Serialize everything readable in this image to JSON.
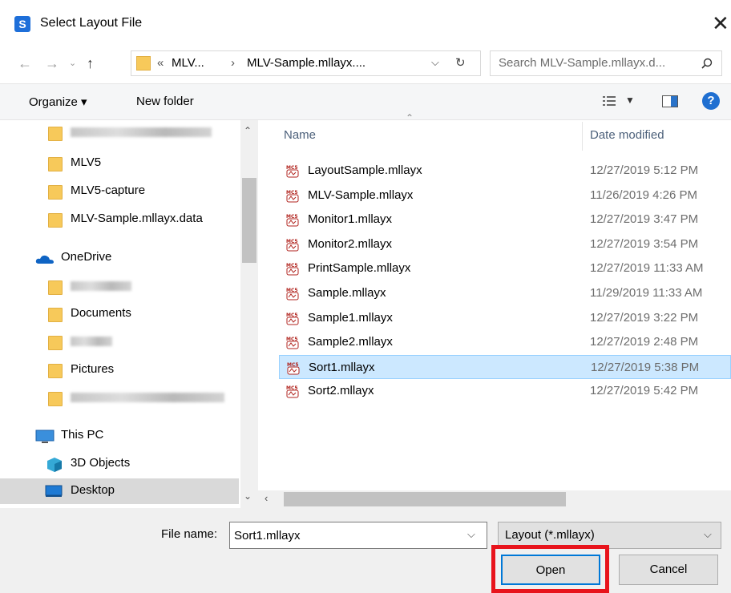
{
  "window": {
    "title": "Select Layout File",
    "app_icon_letter": "S",
    "close_glyph": "✕"
  },
  "address": {
    "path_parts": [
      "«",
      "MLV...",
      "›",
      "MLV-Sample.mllayx...."
    ],
    "search_placeholder": "Search MLV-Sample.mllayx.d..."
  },
  "toolbar": {
    "organize_label": "Organize ▾",
    "new_folder_label": "New folder"
  },
  "nav": {
    "items": [
      {
        "label": "",
        "blurred": true
      },
      {
        "label": "MLV5"
      },
      {
        "label": "MLV5-capture"
      },
      {
        "label": "MLV-Sample.mllayx.data"
      },
      {
        "label": "OneDrive"
      },
      {
        "label": "",
        "blurred": true
      },
      {
        "label": "Documents"
      },
      {
        "label": "",
        "blurred": true
      },
      {
        "label": "Pictures"
      },
      {
        "label": "",
        "blurred": true
      },
      {
        "label": "This PC"
      },
      {
        "label": "3D Objects"
      },
      {
        "label": "Desktop"
      }
    ]
  },
  "file_list": {
    "columns": [
      "Name",
      "Date modified"
    ],
    "files": [
      {
        "name": "LayoutSample.mllayx",
        "date": "12/27/2019 5:12 PM"
      },
      {
        "name": "MLV-Sample.mllayx",
        "date": "11/26/2019 4:26 PM"
      },
      {
        "name": "Monitor1.mllayx",
        "date": "12/27/2019 3:47 PM"
      },
      {
        "name": "Monitor2.mllayx",
        "date": "12/27/2019 3:54 PM"
      },
      {
        "name": "PrintSample.mllayx",
        "date": "12/27/2019 11:33 AM"
      },
      {
        "name": "Sample.mllayx",
        "date": "11/29/2019 11:33 AM"
      },
      {
        "name": "Sample1.mllayx",
        "date": "12/27/2019 3:22 PM"
      },
      {
        "name": "Sample2.mllayx",
        "date": "12/27/2019 2:48 PM"
      },
      {
        "name": "Sort1.mllayx",
        "date": "12/27/2019 5:38 PM"
      },
      {
        "name": "Sort2.mllayx",
        "date": "12/27/2019 5:42 PM"
      }
    ],
    "selected_file": "Sort1.mllayx"
  },
  "bottom": {
    "file_name_label": "File name:",
    "file_name_value": "Sort1.mllayx",
    "file_type_value": "Layout (*.mllayx)",
    "open_label": "Open",
    "cancel_label": "Cancel"
  },
  "colors": {
    "selection": "#cce8ff",
    "highlight_box": "#e8141c",
    "accent": "#0078d7",
    "folder": "#f7c95a"
  }
}
